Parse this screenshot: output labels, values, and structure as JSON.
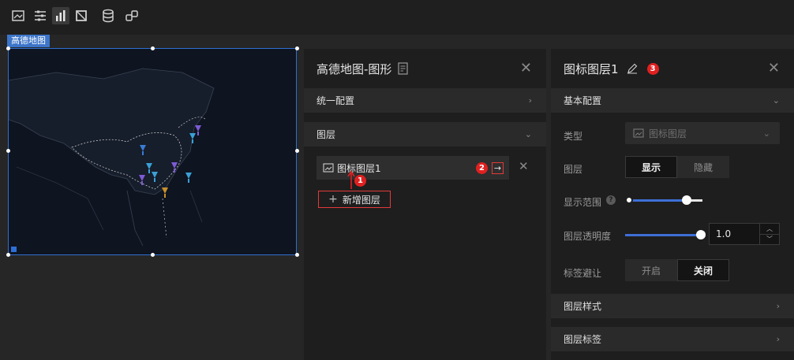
{
  "toolbar": {
    "icons": [
      "image-icon",
      "sliders-icon",
      "bar-chart-icon",
      "crop-icon",
      "database-icon",
      "link-icon"
    ]
  },
  "canvas": {
    "component_tag": "高德地图"
  },
  "left_panel": {
    "title": "高德地图-图形",
    "section_unified": "统一配置",
    "section_layers": "图层",
    "layer_item": "图标图层1",
    "add_layer": "新增图层",
    "badge_1": "1",
    "badge_2": "2",
    "arrow": "→"
  },
  "right_panel": {
    "title": "图标图层1",
    "badge_3": "3",
    "section_basic": "基本配置",
    "type_label": "类型",
    "type_value": "图标图层",
    "layer_label": "图层",
    "show": "显示",
    "hide": "隐藏",
    "range_label": "显示范围",
    "opacity_label": "图层透明度",
    "opacity_value": "1.0",
    "avoid_label": "标签避让",
    "on": "开启",
    "off": "关闭",
    "section_style": "图层样式",
    "section_label": "图层标签"
  },
  "colors": {
    "accent": "#3d6fd6",
    "badge": "#e02020",
    "panel_bg": "#1e1e1e",
    "section_bg": "#2a2a2a"
  }
}
